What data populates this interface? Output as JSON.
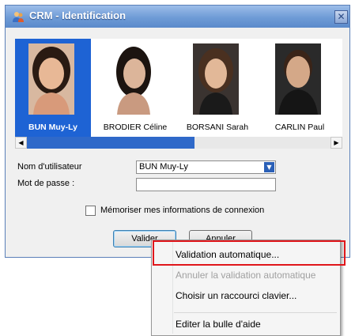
{
  "window": {
    "title": "CRM - Identification",
    "close_glyph": "✕"
  },
  "users": [
    {
      "name": "BUN Muy-Ly",
      "selected": true
    },
    {
      "name": "BRODIER Céline",
      "selected": false
    },
    {
      "name": "BORSANI Sarah",
      "selected": false
    },
    {
      "name": "CARLIN Paul",
      "selected": false
    }
  ],
  "scrollbar": {
    "left_arrow": "◀",
    "right_arrow": "▶"
  },
  "form": {
    "username_label": "Nom d'utilisateur",
    "username_value": "BUN Muy-Ly",
    "password_label": "Mot de passe :",
    "remember_label": "Mémoriser mes informations de connexion"
  },
  "buttons": {
    "validate": "Valider",
    "cancel": "Annuler"
  },
  "context_menu": {
    "items": [
      {
        "label": "Validation automatique...",
        "enabled": true,
        "mnemonic": "V"
      },
      {
        "label": "Annuler la validation automatique",
        "enabled": false
      },
      {
        "label": "Choisir un raccourci clavier...",
        "enabled": true,
        "mnemonic": "C"
      },
      {
        "label": "Editer la bulle d'aide",
        "enabled": true
      }
    ]
  },
  "colors": {
    "selection": "#1e63d4",
    "title_bar": "#6e9bd6",
    "highlight_box": "#e0161b"
  }
}
